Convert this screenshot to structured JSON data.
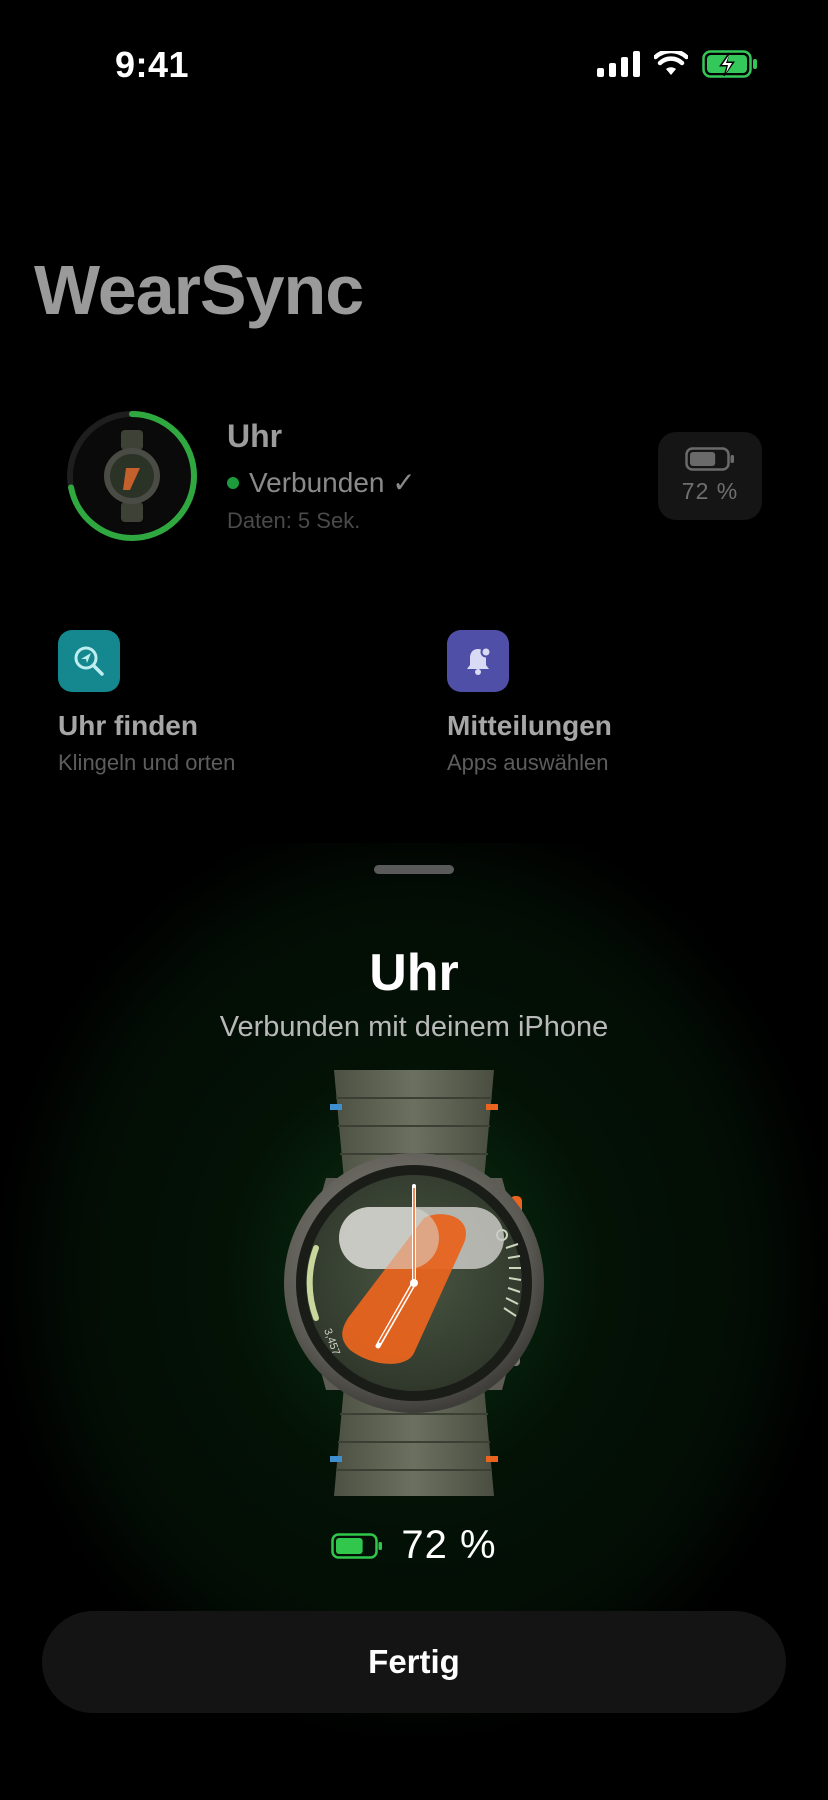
{
  "status_bar": {
    "time": "9:41"
  },
  "app": {
    "title": "WearSync"
  },
  "device": {
    "name": "Uhr",
    "status": "Verbunden ✓",
    "sync_info": "Daten: 5 Sek.",
    "battery_percent_label": "72 %",
    "battery_level": 0.72,
    "status_color": "#1c9a3c"
  },
  "tiles": [
    {
      "title": "Uhr finden",
      "subtitle": "Klingeln und orten",
      "icon": "find-watch-icon",
      "color": "#16a3ad"
    },
    {
      "title": "Mitteilungen",
      "subtitle": "Apps auswählen",
      "icon": "bell-icon",
      "color": "#5e5dc8"
    }
  ],
  "sheet": {
    "title": "Uhr",
    "subtitle": "Verbunden mit deinem iPhone",
    "battery_label": "72 %",
    "battery_level": 0.72,
    "watch_face_value": "3,457",
    "done_label": "Fertig"
  },
  "colors": {
    "accent_green": "#31c64c",
    "orange": "#e8641f"
  }
}
